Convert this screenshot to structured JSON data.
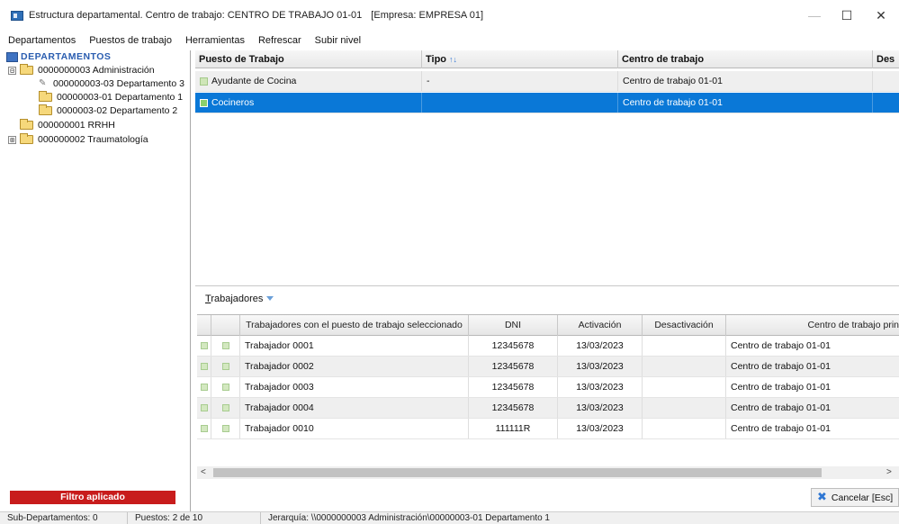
{
  "window": {
    "title": "Estructura departamental. Centro de trabajo: CENTRO DE TRABAJO 01-01",
    "empresa": "[Empresa: EMPRESA 01]",
    "controls": {
      "minimize": "—",
      "maximize": "☐",
      "close": "✕"
    }
  },
  "menu": {
    "items": [
      "Departamentos",
      "Puestos de trabajo",
      "Herramientas",
      "Refrescar",
      "Subir nivel"
    ]
  },
  "tree": {
    "root": "DEPARTAMENTOS",
    "nodes": [
      {
        "label": "0000000003  Administración",
        "expander": "⊟"
      },
      {
        "label": "000000003-03  Departamento 3"
      },
      {
        "label": "00000003-01  Departamento 1"
      },
      {
        "label": "0000003-02  Departamento 2"
      },
      {
        "label": "000000001  RRHH"
      },
      {
        "label": "000000002  Traumatología",
        "expander": "⊞"
      }
    ]
  },
  "upper_grid": {
    "headers": [
      "Puesto de Trabajo",
      "Tipo",
      "Centro de trabajo",
      "Des"
    ],
    "sort_icon": "↑↓",
    "rows": [
      {
        "puesto": "Ayudante de Cocina",
        "tipo": "-",
        "centro": "Centro de trabajo 01-01",
        "selected": false
      },
      {
        "puesto": "Cocineros",
        "tipo": "",
        "centro": "Centro de trabajo 01-01",
        "selected": true
      }
    ]
  },
  "tab": {
    "label_first": "T",
    "label_rest": "rabajadores"
  },
  "lower_grid": {
    "headers": [
      "Trabajadores con el puesto de trabajo seleccionado",
      "DNI",
      "Activación",
      "Desactivación",
      "Centro de trabajo prin"
    ],
    "rows": [
      {
        "nombre": "Trabajador 0001",
        "dni": "12345678",
        "activacion": "13/03/2023",
        "desactivacion": "",
        "centro": "Centro de trabajo 01-01"
      },
      {
        "nombre": "Trabajador 0002",
        "dni": "12345678",
        "activacion": "13/03/2023",
        "desactivacion": "",
        "centro": "Centro de trabajo 01-01"
      },
      {
        "nombre": "Trabajador 0003",
        "dni": "12345678",
        "activacion": "13/03/2023",
        "desactivacion": "",
        "centro": "Centro de trabajo 01-01"
      },
      {
        "nombre": "Trabajador 0004",
        "dni": "12345678",
        "activacion": "13/03/2023",
        "desactivacion": "",
        "centro": "Centro de trabajo 01-01"
      },
      {
        "nombre": "Trabajador 0010",
        "dni": "111111R",
        "activacion": "13/03/2023",
        "desactivacion": "",
        "centro": "Centro de trabajo 01-01"
      }
    ]
  },
  "scrollbar": {
    "left_arrow": "<",
    "right_arrow": ">"
  },
  "bottom": {
    "filter_badge": "Filtro aplicado",
    "cancel_label": "Cancelar [Esc]"
  },
  "status": {
    "subdepartamentos": "Sub-Departamentos: 0",
    "puestos": "Puestos: 2 de 10",
    "jerarquia": "Jerarquía: \\\\0000000003  Administración\\00000003-01  Departamento 1"
  },
  "colors": {
    "selection": "#0a78d7",
    "filter_badge": "#c81c1c",
    "folder": "#f6d87b",
    "tree_root": "#2a5db0"
  }
}
